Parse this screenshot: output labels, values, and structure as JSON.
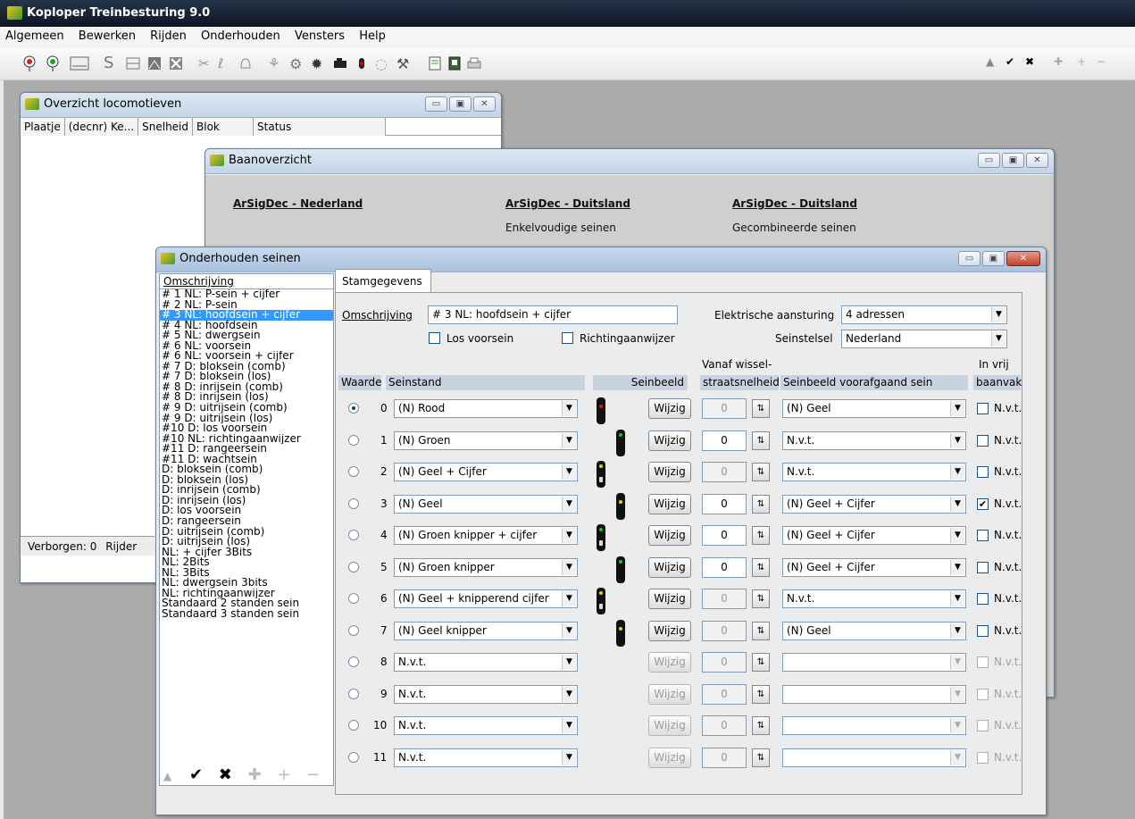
{
  "app": {
    "title": "Koploper Treinbesturing 9.0"
  },
  "menu": [
    "Algemeen",
    "Bewerken",
    "Rijden",
    "Onderhouden",
    "Vensters",
    "Help"
  ],
  "toolbar_right": [
    "▲",
    "✔",
    "✖",
    "✚",
    "+",
    "−"
  ],
  "loco_window": {
    "title": "Overzicht locomotieven",
    "columns": [
      "Plaatje",
      "(decnr) Ke...",
      "Snelheid",
      "Blok",
      "Status"
    ],
    "status": "Verborgen: 0",
    "status2": "Rijder"
  },
  "baan_window": {
    "title": "Baanoverzicht",
    "links": [
      {
        "title": "ArSigDec - Nederland",
        "sub": ""
      },
      {
        "title": "ArSigDec - Duitsland",
        "sub": "Enkelvoudige seinen"
      },
      {
        "title": "ArSigDec - Duitsland",
        "sub": "Gecombineerde seinen"
      }
    ]
  },
  "seinen_window": {
    "title": "Onderhouden seinen",
    "list_header": "Omschrijving",
    "list": [
      "# 1 NL: P-sein + cijfer",
      "# 2 NL: P-sein",
      "# 3 NL: hoofdsein + cijfer",
      "# 4 NL: hoofdsein",
      "# 5 NL: dwergsein",
      "# 6 NL: voorsein",
      "# 6 NL: voorsein + cijfer",
      "# 7 D: bloksein (comb)",
      "# 7 D: bloksein (los)",
      "# 8 D: inrijsein (comb)",
      "# 8 D: inrijsein (los)",
      "# 9 D: uitrijsein (comb)",
      "# 9 D: uitrijsein (los)",
      "#10 D: los voorsein",
      "#10 NL: richtingaanwijzer",
      "#11 D: rangeersein",
      "#11 D: wachtsein",
      "D: bloksein (comb)",
      "D: bloksein (los)",
      "D: inrijsein (comb)",
      "D: inrijsein (los)",
      "D: los voorsein",
      "D: rangeersein",
      "D: uitrijsein (comb)",
      "D: uitrijsein (los)",
      "NL: + cijfer 3Bits",
      "NL: 2Bits",
      "NL: 3Bits",
      "NL: dwergsein 3bits",
      "NL: richtingaanwijzer",
      "Standaard 2 standen sein",
      "Standaard 3 standen sein"
    ],
    "selected_index": 2,
    "bottom_buttons": [
      "▲",
      "✔",
      "✖",
      "✚",
      "+",
      "−"
    ],
    "tab": "Stamgegevens",
    "omschrijving_label": "Omschrijving",
    "omschrijving_value": "# 3 NL: hoofdsein + cijfer",
    "elektrische_label": "Elektrische aansturing",
    "elektrische_value": "4 adressen",
    "seinstelsel_label": "Seinstelsel",
    "seinstelsel_value": "Nederland",
    "los_voorsein": "Los voorsein",
    "richtingaanwijzer": "Richtingaanwijzer",
    "headers": {
      "waarde": "Waarde",
      "seinstand": "Seinstand",
      "seinbeeld": "Seinbeeld",
      "vanaf1": "Vanaf wissel-",
      "vanaf2": "straatsnelheid",
      "voorafgaand": "Seinbeeld voorafgaand sein",
      "vrij1": "In vrij",
      "vrij2": "baanvak"
    },
    "wijzig": "Wijzig",
    "rows": [
      {
        "waarde": "0",
        "seinstand": "(N) Rood",
        "speed": "0",
        "voorafgaand": "(N) Geel",
        "nvt": "N.v.t.",
        "checked": false,
        "selected": true,
        "enabled": true,
        "speed_enabled": false
      },
      {
        "waarde": "1",
        "seinstand": "(N) Groen",
        "speed": "0",
        "voorafgaand": "N.v.t.",
        "nvt": "N.v.t.",
        "checked": false,
        "selected": false,
        "enabled": true,
        "speed_enabled": true
      },
      {
        "waarde": "2",
        "seinstand": "(N) Geel + Cijfer",
        "speed": "0",
        "voorafgaand": "N.v.t.",
        "nvt": "N.v.t.",
        "checked": false,
        "selected": false,
        "enabled": true,
        "speed_enabled": false
      },
      {
        "waarde": "3",
        "seinstand": "(N) Geel",
        "speed": "0",
        "voorafgaand": "(N) Geel + Cijfer",
        "nvt": "N.v.t.",
        "checked": true,
        "selected": false,
        "enabled": true,
        "speed_enabled": true
      },
      {
        "waarde": "4",
        "seinstand": "(N) Groen knipper + cijfer",
        "speed": "0",
        "voorafgaand": "(N) Geel + Cijfer",
        "nvt": "N.v.t.",
        "checked": false,
        "selected": false,
        "enabled": true,
        "speed_enabled": true
      },
      {
        "waarde": "5",
        "seinstand": "(N) Groen knipper",
        "speed": "0",
        "voorafgaand": "(N) Geel + Cijfer",
        "nvt": "N.v.t.",
        "checked": false,
        "selected": false,
        "enabled": true,
        "speed_enabled": true
      },
      {
        "waarde": "6",
        "seinstand": "(N) Geel + knipperend cijfer",
        "speed": "0",
        "voorafgaand": "N.v.t.",
        "nvt": "N.v.t.",
        "checked": false,
        "selected": false,
        "enabled": true,
        "speed_enabled": false
      },
      {
        "waarde": "7",
        "seinstand": "(N) Geel knipper",
        "speed": "0",
        "voorafgaand": "(N) Geel",
        "nvt": "N.v.t.",
        "checked": false,
        "selected": false,
        "enabled": true,
        "speed_enabled": false
      },
      {
        "waarde": "8",
        "seinstand": "N.v.t.",
        "speed": "0",
        "voorafgaand": "",
        "nvt": "N.v.t.",
        "checked": false,
        "selected": false,
        "enabled": false,
        "speed_enabled": false
      },
      {
        "waarde": "9",
        "seinstand": "N.v.t.",
        "speed": "0",
        "voorafgaand": "",
        "nvt": "N.v.t.",
        "checked": false,
        "selected": false,
        "enabled": false,
        "speed_enabled": false
      },
      {
        "waarde": "10",
        "seinstand": "N.v.t.",
        "speed": "0",
        "voorafgaand": "",
        "nvt": "N.v.t.",
        "checked": false,
        "selected": false,
        "enabled": false,
        "speed_enabled": false
      },
      {
        "waarde": "11",
        "seinstand": "N.v.t.",
        "speed": "0",
        "voorafgaand": "",
        "nvt": "N.v.t.",
        "checked": false,
        "selected": false,
        "enabled": false,
        "speed_enabled": false
      }
    ]
  }
}
